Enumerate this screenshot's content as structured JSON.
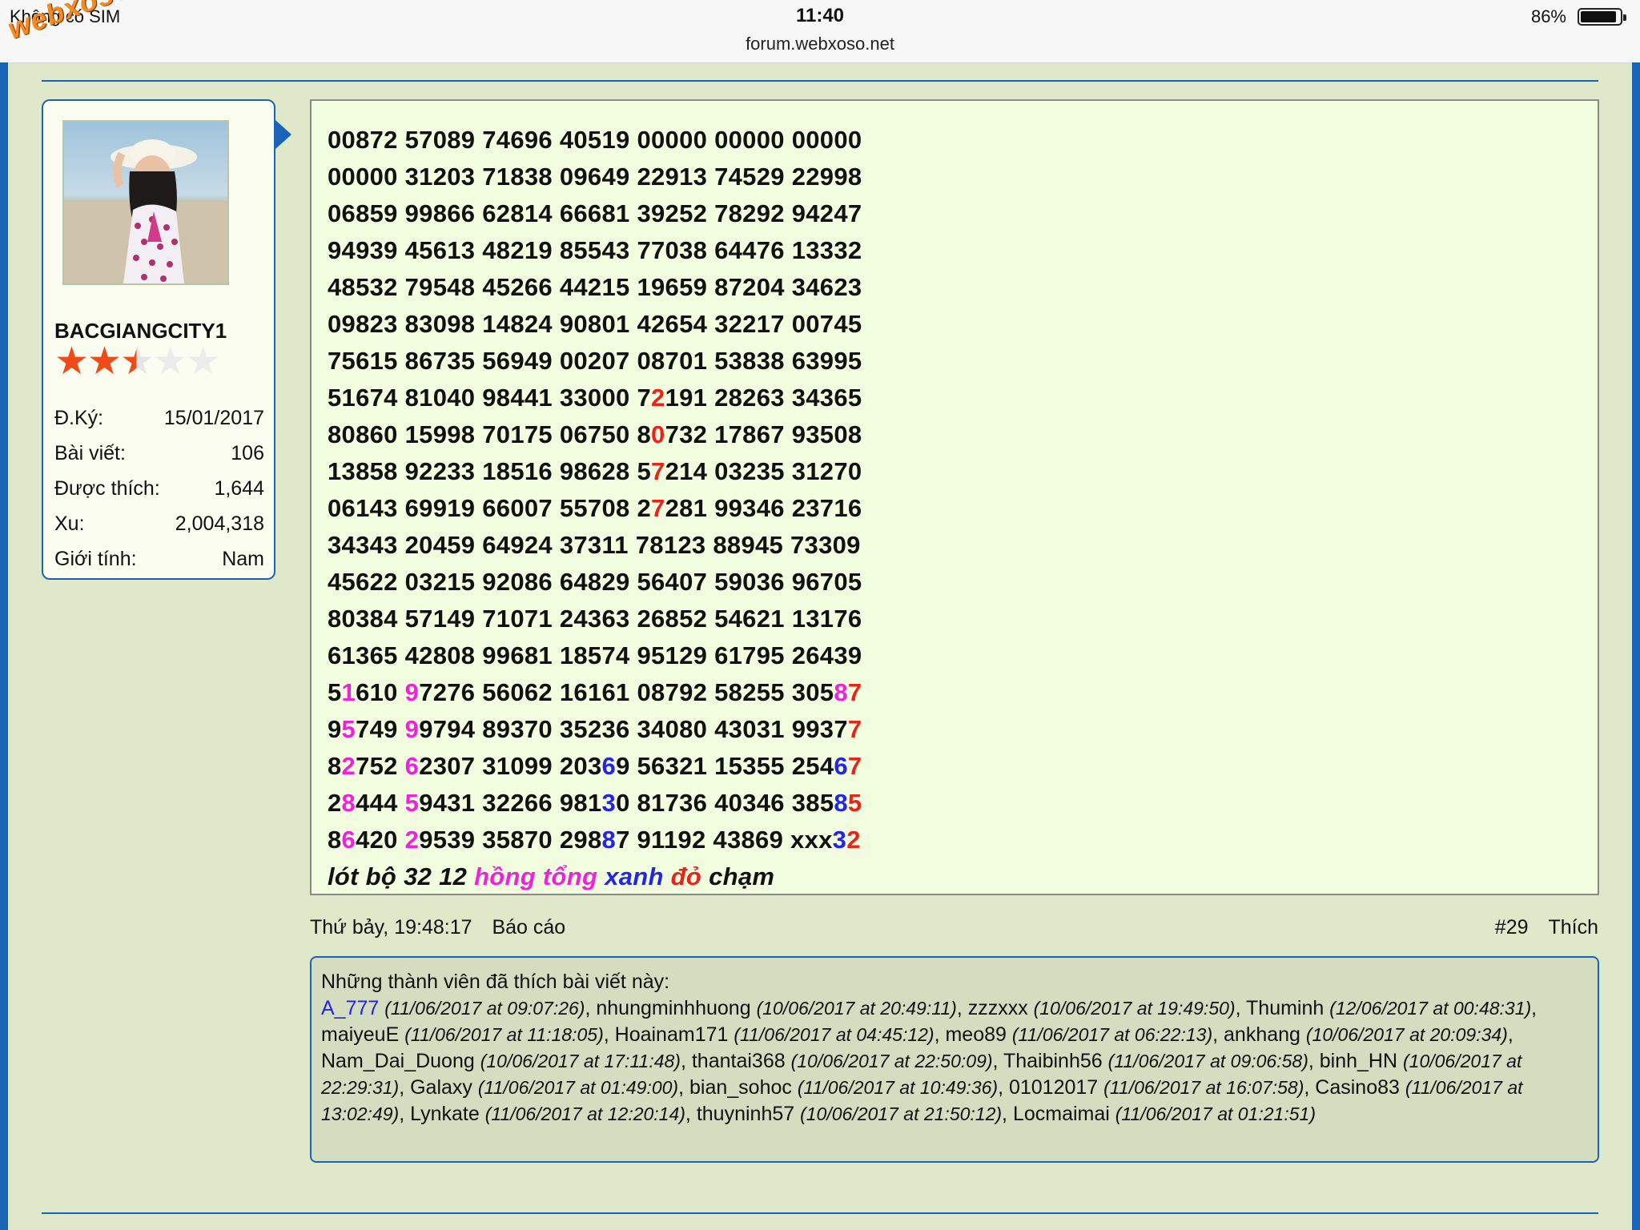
{
  "status_bar": {
    "carrier": "Không có SIM",
    "time": "11:40",
    "url": "forum.webxoso.net",
    "battery": "86%",
    "battery_level": 0.86
  },
  "watermark": "webxoso.net",
  "user": {
    "name": "BACGIANGCITY1",
    "rating_stars": 2.5,
    "rating_max": 5,
    "stats": [
      {
        "label": "Đ.Ký:",
        "value": "15/01/2017"
      },
      {
        "label": "Bài viết:",
        "value": "106"
      },
      {
        "label": "Được thích:",
        "value": "1,644"
      },
      {
        "label": "Xu:",
        "value": "2,004,318"
      },
      {
        "label": "Giới tính:",
        "value": "Nam"
      }
    ]
  },
  "post": {
    "lines": [
      [
        {
          "t": "00872 57089 74696 40519 00000 00000 00000"
        }
      ],
      [
        {
          "t": "00000 31203 71838 09649 22913 74529 22998"
        }
      ],
      [
        {
          "t": "06859 99866 62814 66681 39252 78292 94247"
        }
      ],
      [
        {
          "t": "94939 45613 48219 85543 77038 64476 13332"
        }
      ],
      [
        {
          "t": "48532 79548 45266 44215 19659 87204 34623"
        }
      ],
      [
        {
          "t": "09823 83098 14824 90801 42654 32217 00745"
        }
      ],
      [
        {
          "t": "75615 86735 56949 00207 08701 53838 63995"
        }
      ],
      [
        {
          "t": "51674 81040 98441 33000 7"
        },
        {
          "t": "2",
          "c": "red"
        },
        {
          "t": "191 28263 34365"
        }
      ],
      [
        {
          "t": "80860 15998 70175 06750 8"
        },
        {
          "t": "0",
          "c": "red"
        },
        {
          "t": "732 17867 93508"
        }
      ],
      [
        {
          "t": "13858 92233 18516 98628 5"
        },
        {
          "t": "7",
          "c": "red"
        },
        {
          "t": "214 03235 31270"
        }
      ],
      [
        {
          "t": "06143 69919 66007 55708 2"
        },
        {
          "t": "7",
          "c": "red"
        },
        {
          "t": "281 99346 23716"
        }
      ],
      [
        {
          "t": "34343 20459 64924 37311 78123 88945 73309"
        }
      ],
      [
        {
          "t": "45622 03215 92086 64829 56407 59036 96705"
        }
      ],
      [
        {
          "t": "80384 57149 71071 24363 26852 54621 13176"
        }
      ],
      [
        {
          "t": "61365 42808 99681 18574 95129 61795 26439"
        }
      ],
      [
        {
          "t": "5"
        },
        {
          "t": "1",
          "c": "pink"
        },
        {
          "t": "610 "
        },
        {
          "t": "9",
          "c": "pink"
        },
        {
          "t": "7276 56062 16161 08792 58255 305"
        },
        {
          "t": "8",
          "c": "pink"
        },
        {
          "t": "7",
          "c": "red"
        }
      ],
      [
        {
          "t": "9"
        },
        {
          "t": "5",
          "c": "pink"
        },
        {
          "t": "749 "
        },
        {
          "t": "9",
          "c": "pink"
        },
        {
          "t": "9794 89370 35236 34080 43031 9937"
        },
        {
          "t": "7",
          "c": "red"
        }
      ],
      [
        {
          "t": "8"
        },
        {
          "t": "2",
          "c": "pink"
        },
        {
          "t": "752 "
        },
        {
          "t": "6",
          "c": "pink"
        },
        {
          "t": "2307 31099 203"
        },
        {
          "t": "6",
          "c": "blue"
        },
        {
          "t": "9 56321 15355 254"
        },
        {
          "t": "6",
          "c": "blue"
        },
        {
          "t": "7",
          "c": "red"
        }
      ],
      [
        {
          "t": "2"
        },
        {
          "t": "8",
          "c": "pink"
        },
        {
          "t": "444 "
        },
        {
          "t": "5",
          "c": "pink"
        },
        {
          "t": "9431 32266 981"
        },
        {
          "t": "3",
          "c": "blue"
        },
        {
          "t": "0 81736 40346 385"
        },
        {
          "t": "8",
          "c": "blue"
        },
        {
          "t": "5",
          "c": "red"
        }
      ],
      [
        {
          "t": "8"
        },
        {
          "t": "6",
          "c": "pink"
        },
        {
          "t": "420 "
        },
        {
          "t": "2",
          "c": "pink"
        },
        {
          "t": "9539 35870 298"
        },
        {
          "t": "8",
          "c": "blue"
        },
        {
          "t": "7 91192 43869 xxx"
        },
        {
          "t": "3",
          "c": "blue"
        },
        {
          "t": "2",
          "c": "red"
        }
      ],
      [
        {
          "t": "lót bộ 32 12 ",
          "i": true
        },
        {
          "t": "hồng tổng",
          "c": "pink",
          "i": true
        },
        {
          "t": " "
        },
        {
          "t": "xanh",
          "c": "blue",
          "i": true
        },
        {
          "t": " "
        },
        {
          "t": "đỏ",
          "c": "red",
          "i": true
        },
        {
          "t": " chạm",
          "i": true
        }
      ]
    ],
    "date": "Thứ bảy, 19:48:17",
    "report": "Báo cáo",
    "number": "#29",
    "like": "Thích"
  },
  "likes": {
    "heading": "Những thành viên đã thích bài viết này:",
    "members": [
      {
        "name": "A_777",
        "ts": "(11/06/2017 at 09:07:26)"
      },
      {
        "name": "nhungminhhuong",
        "ts": "(10/06/2017 at 20:49:11)"
      },
      {
        "name": "zzzxxx",
        "ts": "(10/06/2017 at 19:49:50)"
      },
      {
        "name": "Thuminh",
        "ts": "(12/06/2017 at 00:48:31)"
      },
      {
        "name": "maiyeuE",
        "ts": "(11/06/2017 at 11:18:05)"
      },
      {
        "name": "Hoainam171",
        "ts": "(11/06/2017 at 04:45:12)"
      },
      {
        "name": "meo89",
        "ts": "(11/06/2017 at 06:22:13)"
      },
      {
        "name": "ankhang",
        "ts": "(10/06/2017 at 20:09:34)"
      },
      {
        "name": "Nam_Dai_Duong",
        "ts": "(10/06/2017 at 17:11:48)"
      },
      {
        "name": "thantai368",
        "ts": "(10/06/2017 at 22:50:09)"
      },
      {
        "name": "Thaibinh56",
        "ts": "(11/06/2017 at 09:06:58)"
      },
      {
        "name": "binh_HN",
        "ts": "(10/06/2017 at 22:29:31)"
      },
      {
        "name": "Galaxy",
        "ts": "(11/06/2017 at 01:49:00)"
      },
      {
        "name": "bian_sohoc",
        "ts": "(11/06/2017 at 10:49:36)"
      },
      {
        "name": "01012017",
        "ts": "(11/06/2017 at 16:07:58)"
      },
      {
        "name": "Casino83",
        "ts": "(11/06/2017 at 13:02:49)"
      },
      {
        "name": "Lynkate",
        "ts": "(11/06/2017 at 12:20:14)"
      },
      {
        "name": "thuyninh57",
        "ts": "(10/06/2017 at 21:50:12)"
      },
      {
        "name": "Locmaimai",
        "ts": "(11/06/2017 at 01:21:51)"
      }
    ]
  }
}
